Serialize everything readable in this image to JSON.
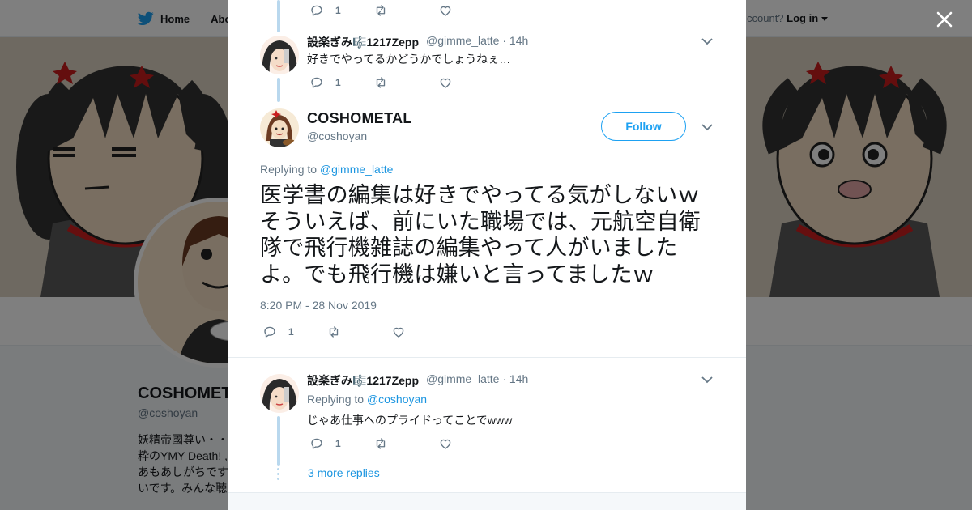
{
  "background": {
    "nav": {
      "home_label": "Home",
      "about_label": "Abo"
    },
    "login": {
      "prompt": "ccount?",
      "login_label": "Log in"
    },
    "profile": {
      "name": "COSHOMET",
      "handle": "@coshoyan",
      "bio_lines": [
        "妖精帝國尊い・・",
        "粋のYMY Death! ,",
        "あもあしがちです",
        "いです。みんな聴"
      ]
    }
  },
  "colors": {
    "accent": "#1da1f2",
    "link": "#1b95e0",
    "muted": "#657786",
    "thread": "#b9d8ee"
  },
  "thread": {
    "top_actions": {
      "reply_count": "1"
    },
    "parent": {
      "name": "設楽ぎみ🎼1217Zepp",
      "handle": "@gimme_latte",
      "time": "14h",
      "text": "好きでやってるかどうかでしょうねぇ…",
      "reply_count": "1"
    },
    "main": {
      "name": "COSHOMETAL",
      "handle": "@coshoyan",
      "follow_label": "Follow",
      "replying_label": "Replying to",
      "replying_to": "@gimme_latte",
      "text": "医学書の編集は好きでやってる気がしないｗ　そういえば、前にいた職場では、元航空自衛隊で飛行機雑誌の編集やって人がいましたよ。でも飛行機は嫌いと言ってましたｗ",
      "timestamp": "8:20 PM - 28 Nov 2019",
      "reply_count": "1"
    },
    "reply": {
      "name": "設楽ぎみ🎼1217Zepp",
      "handle": "@gimme_latte",
      "time": "14h",
      "replying_label": "Replying to",
      "replying_to": "@coshoyan",
      "text": "じゃあ仕事へのプライドってことでwww",
      "reply_count": "1"
    },
    "more_replies_label": "3 more replies"
  },
  "icons": [
    "twitter-bird-icon",
    "caret-down-icon",
    "close-icon",
    "reply-icon",
    "retweet-icon",
    "like-icon",
    "chevron-down-icon"
  ]
}
